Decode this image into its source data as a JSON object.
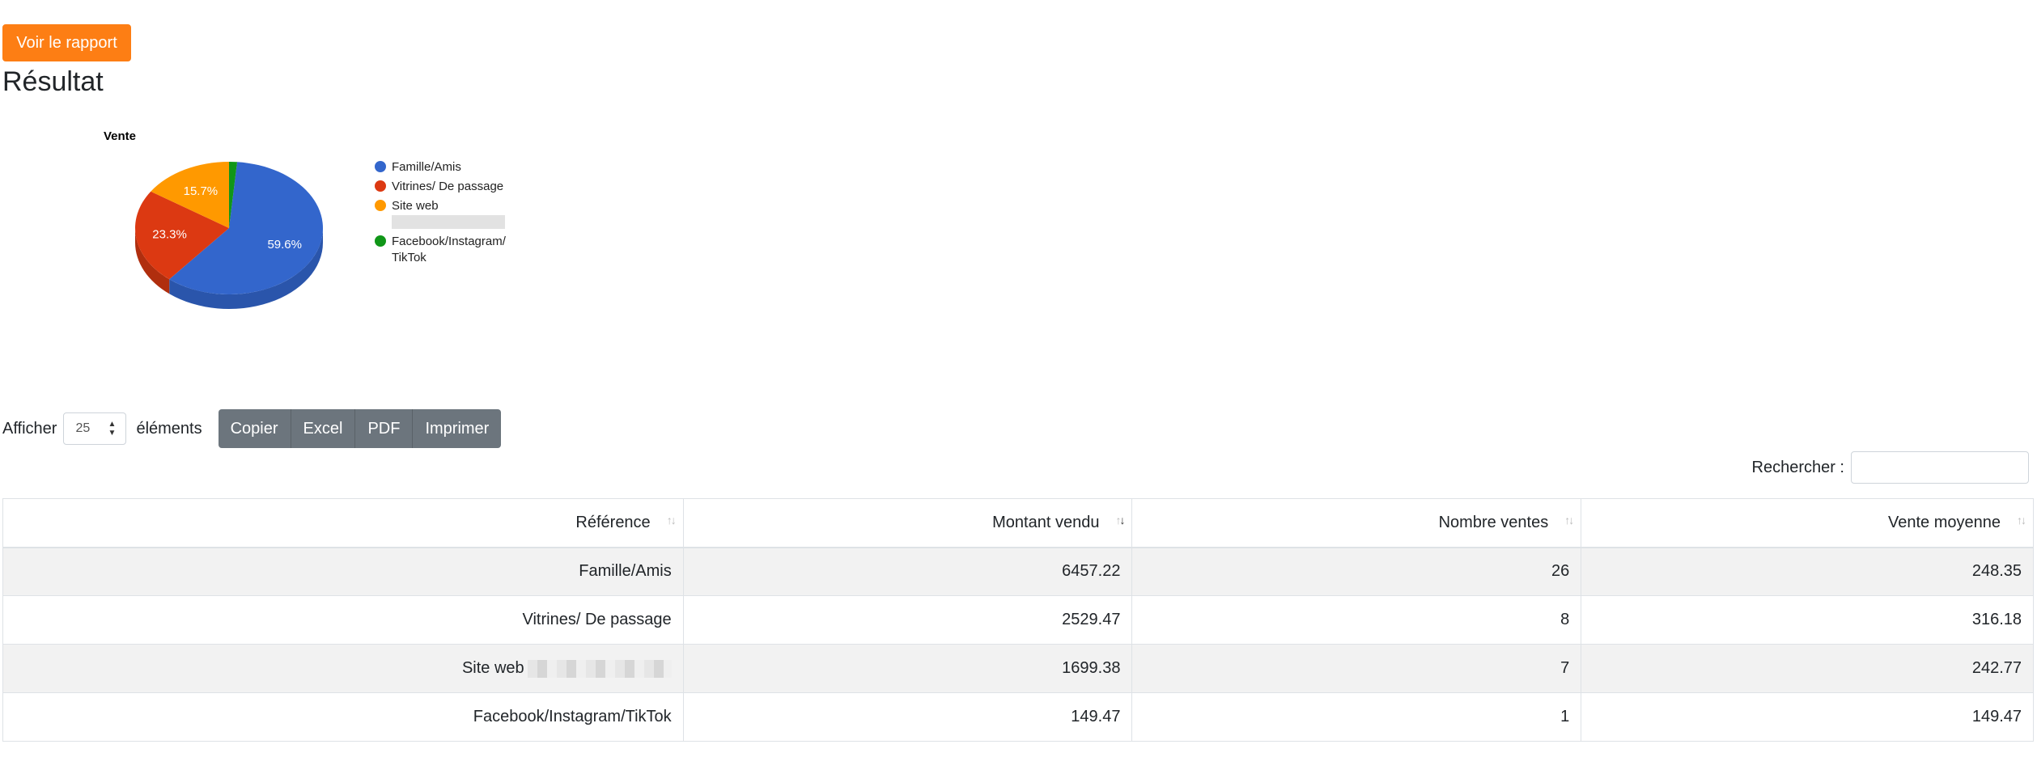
{
  "header": {
    "report_button": "Voir le rapport",
    "title": "Résultat"
  },
  "chart_data": {
    "type": "pie",
    "title": "Vente",
    "is_3d": true,
    "legend_position": "right",
    "categories": [
      "Famille/Amis",
      "Vitrines/ De passage",
      "Site web",
      "Facebook/Instagram/ TikTok"
    ],
    "values": [
      6457.22,
      2529.47,
      1699.38,
      149.47
    ],
    "labels": [
      "59.6%",
      "23.3%",
      "15.7%",
      ""
    ],
    "colors": [
      "#3366cc",
      "#dc3912",
      "#ff9900",
      "#109618"
    ],
    "side_colors": [
      "#2a55ab",
      "#b02e0e",
      "#cc7a00",
      "#0d7a13"
    ]
  },
  "controls": {
    "show_label": "Afficher",
    "length_value": "25",
    "elements_label": "éléments",
    "buttons": [
      "Copier",
      "Excel",
      "PDF",
      "Imprimer"
    ],
    "search_label": "Rechercher :",
    "search_placeholder": ""
  },
  "table": {
    "columns": [
      "Référence",
      "Montant vendu",
      "Nombre ventes",
      "Vente moyenne"
    ],
    "rows": [
      [
        "Famille/Amis",
        "6457.22",
        "26",
        "248.35"
      ],
      [
        "Vitrines/ De passage",
        "2529.47",
        "8",
        "316.18"
      ],
      [
        "Site web",
        "1699.38",
        "7",
        "242.77"
      ],
      [
        "Facebook/Instagram/TikTok",
        "149.47",
        "1",
        "149.47"
      ]
    ]
  },
  "colors": {
    "accent": "#fd7e14",
    "button_secondary": "#6c757d"
  }
}
